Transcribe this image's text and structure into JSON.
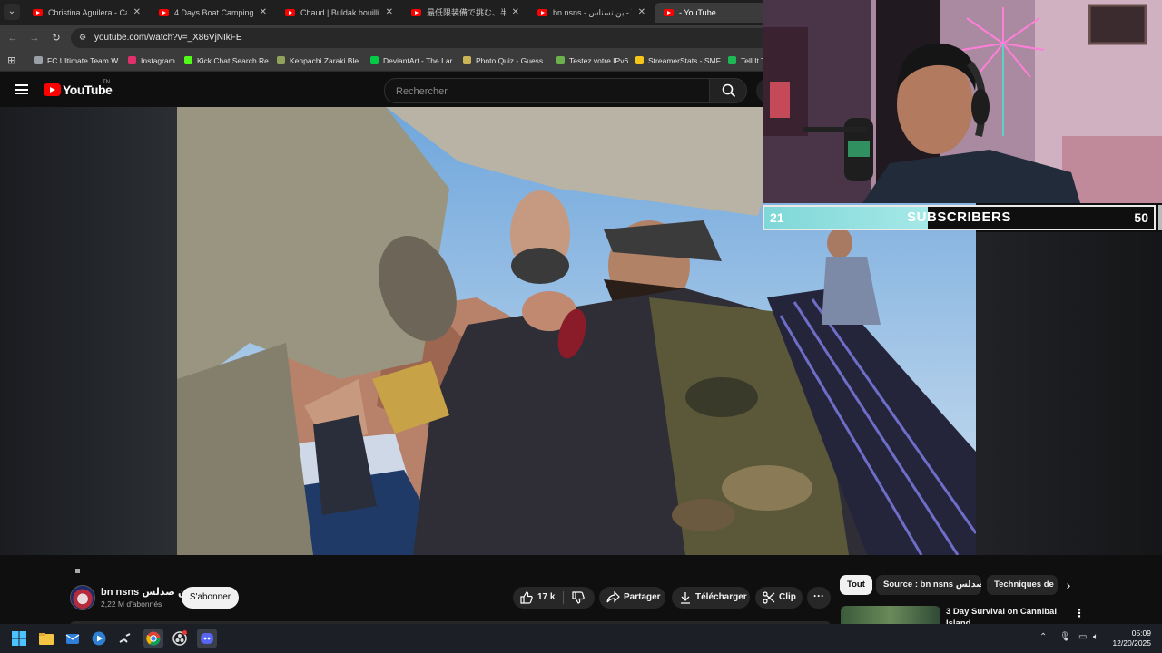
{
  "browser": {
    "tabs": [
      {
        "label": "Christina Aguilera - Can't",
        "active": false
      },
      {
        "label": "4 Days Boat Camping & C",
        "active": false
      },
      {
        "label": "Chaud | Buldak bouilli avec",
        "active": false
      },
      {
        "label": "最低限装備で挑む、半サバイ",
        "active": false
      },
      {
        "label": "bn nsns - بن نسناس - YouTube",
        "active": false
      },
      {
        "label": "- YouTube",
        "active": true
      }
    ],
    "url": "youtube.com/watch?v=_X86VjNIkFE",
    "bookmarks": [
      {
        "label": "FC Ultimate Team W...",
        "icon": "fc-icon",
        "color": "#9aa0a6"
      },
      {
        "label": "Instagram",
        "icon": "instagram-icon",
        "color": "#e1306c"
      },
      {
        "label": "Kick Chat Search Re...",
        "icon": "kick-icon",
        "color": "#53fc18"
      },
      {
        "label": "Kenpachi Zaraki Ble...",
        "icon": "kenpachi-icon",
        "color": "#8fa35c"
      },
      {
        "label": "DeviantArt - The Lar...",
        "icon": "deviantart-icon",
        "color": "#05cc47"
      },
      {
        "label": "Photo Quiz - Guess...",
        "icon": "photoquiz-icon",
        "color": "#c9b458"
      },
      {
        "label": "Testez votre IPv6.",
        "icon": "ipv6-icon",
        "color": "#6ab04c"
      },
      {
        "label": "StreamerStats - SMF...",
        "icon": "streamerstats-icon",
        "color": "#f5c518"
      },
      {
        "label": "Tell It T",
        "icon": "spotify-icon",
        "color": "#1db954"
      }
    ]
  },
  "youtube": {
    "logo_text": "YouTube",
    "logo_tm": "TN",
    "search_placeholder": "Rechercher",
    "channel": {
      "name": "bn nsns بن صدلس",
      "subscribers": "2,22 M d'abonnés",
      "subscribe_label": "S'abonner"
    },
    "actions": {
      "likes": "17 k",
      "share": "Partager",
      "download": "Télécharger",
      "clip": "Clip",
      "more": "···"
    },
    "chips": [
      "Tout",
      "Source : bn nsns بن صدلس",
      "Techniques de"
    ],
    "recommendation": {
      "title": "3 Day Survival on Cannibal Island",
      "menu": "⋮"
    }
  },
  "overlay": {
    "subscriber_current": "21",
    "subscriber_label": "SUBSCRIBERS",
    "subscriber_goal": "50",
    "progress_fraction": 0.42
  },
  "taskbar": {
    "time": "05:09",
    "date": "12/20/2025"
  },
  "colors": {
    "youtube_red": "#ff0000",
    "overlay_fill": "#7fd7d7"
  }
}
